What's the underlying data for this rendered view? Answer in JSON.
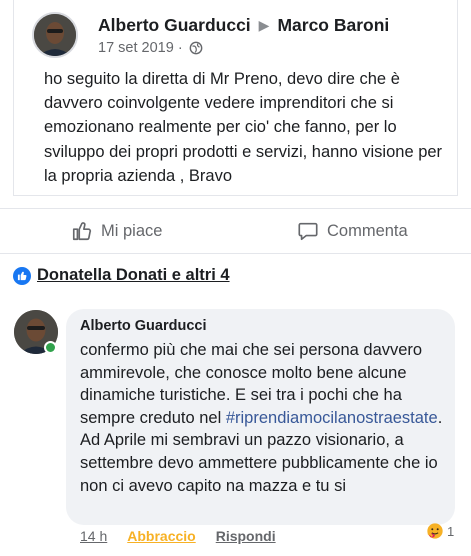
{
  "post": {
    "author": "Alberto Guarducci",
    "arrow": "▶",
    "recipient": "Marco Baroni",
    "date": "17 set 2019 ·",
    "text": "ho seguito la diretta di Mr Preno, devo dire che è davvero coinvolgente vedere imprenditori che si emozionano realmente per cio' che fanno, per lo sviluppo dei propri prodotti e servizi, hanno visione per la propria azienda , Bravo"
  },
  "actions": {
    "like_label": "Mi piace",
    "comment_label": "Commenta"
  },
  "reactions": {
    "names": "Donatella Donati e altri 4"
  },
  "comment": {
    "author": "Alberto Guarducci",
    "text_before": "confermo più che mai che sei persona davvero ammirevole, che conosce molto bene alcune dinamiche turistiche.  E sei tra i pochi che ha sempre creduto nel ",
    "hashtag": "#riprendiamocilanostraestate",
    "text_after": ". Ad Aprile mi sembravi un pazzo visionario, a settembre devo ammettere pubblicamente che io non ci avevo capito na mazza e tu si",
    "time": "14 h",
    "react_label": "Abbraccio",
    "reply_label": "Rispondi",
    "reaction_count": "1"
  },
  "colors": {
    "link_blue": "#385898",
    "like_blue": "#1877f2",
    "online_green": "#31a24c",
    "hug_yellow": "#f7b125"
  },
  "icons": [
    "globe-icon",
    "thumbs-up-icon",
    "comment-icon",
    "like-badge-icon",
    "hug-reaction-icon"
  ]
}
